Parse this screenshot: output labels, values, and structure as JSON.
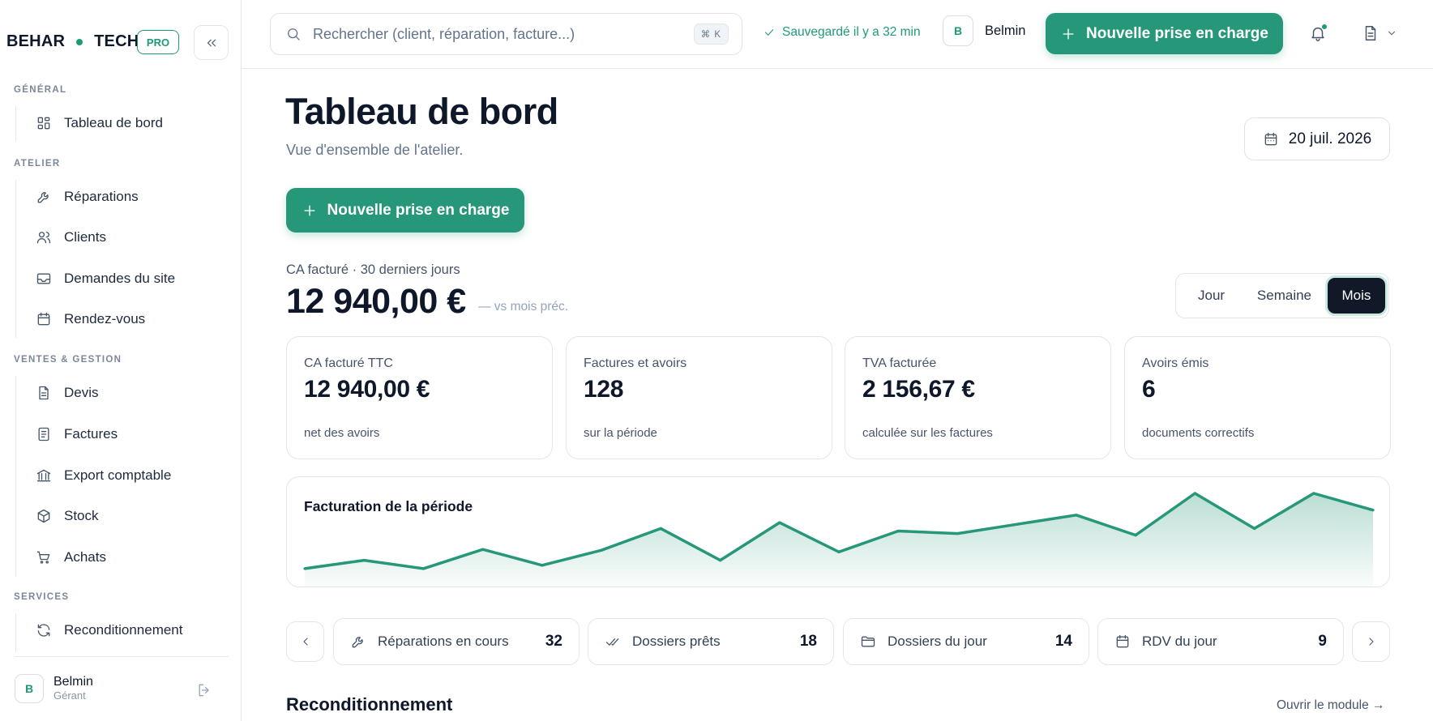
{
  "brand": {
    "left": "BEHAR",
    "right": "TECH",
    "badge": "PRO"
  },
  "sidebar": {
    "sections": [
      "GÉNÉRAL",
      "ATELIER",
      "VENTES & GESTION",
      "SERVICES"
    ],
    "items": [
      {
        "label": "Tableau de bord",
        "icon": "grid-icon"
      },
      {
        "label": "Réparations",
        "icon": "wrench-icon"
      },
      {
        "label": "Clients",
        "icon": "users-icon"
      },
      {
        "label": "Demandes du site",
        "icon": "inbox-icon"
      },
      {
        "label": "Rendez-vous",
        "icon": "calendar-icon"
      },
      {
        "label": "Devis",
        "icon": "document-icon"
      },
      {
        "label": "Factures",
        "icon": "invoice-icon"
      },
      {
        "label": "Export comptable",
        "icon": "bank-icon"
      },
      {
        "label": "Stock",
        "icon": "box-icon"
      },
      {
        "label": "Achats",
        "icon": "cart-icon"
      },
      {
        "label": "Reconditionnement",
        "icon": "refresh-icon"
      }
    ],
    "user": {
      "initial": "B",
      "name": "Belmin",
      "role": "Gérant"
    }
  },
  "topbar": {
    "search_placeholder": "Rechercher (client, réparation, facture...)",
    "shortcut": "⌘ K",
    "saved": "Sauvegardé il y a 32 min",
    "user_initial": "B",
    "user_name": "Belmin",
    "new_button": "Nouvelle prise en charge"
  },
  "main": {
    "title": "Tableau de bord",
    "subtitle": "Vue d'ensemble de l'atelier.",
    "date": "20 juil. 2026",
    "new_button": "Nouvelle prise en charge",
    "ca_label": "CA facturé · 30 derniers jours",
    "ca_value": "12 940,00 €",
    "ca_vs": "— vs mois préc.",
    "periods": [
      "Jour",
      "Semaine",
      "Mois"
    ],
    "active_period": "Mois",
    "cards": [
      {
        "label": "CA facturé TTC",
        "value": "12 940,00 €",
        "sub": "net des avoirs"
      },
      {
        "label": "Factures et avoirs",
        "value": "128",
        "sub": "sur la période"
      },
      {
        "label": "TVA facturée",
        "value": "2 156,67 €",
        "sub": "calculée sur les factures"
      },
      {
        "label": "Avoirs émis",
        "value": "6",
        "sub": "documents correctifs"
      }
    ],
    "stats": [
      {
        "label": "Réparations en cours",
        "value": "32",
        "icon": "wrench-icon"
      },
      {
        "label": "Dossiers prêts",
        "value": "18",
        "icon": "double-check-icon"
      },
      {
        "label": "Dossiers du jour",
        "value": "14",
        "icon": "folder-icon"
      },
      {
        "label": "RDV du jour",
        "value": "9",
        "icon": "calendar-icon"
      }
    ],
    "section_title": "Reconditionnement",
    "section_link": "Ouvrir le module →"
  },
  "colors": {
    "accent": "#27977a",
    "dark": "#111827"
  },
  "chart_data": {
    "type": "area",
    "title": "Facturation de la période",
    "values": [
      2,
      12,
      2,
      25,
      6,
      24,
      50,
      12,
      57,
      22,
      47,
      44,
      55,
      66,
      42,
      92,
      50,
      92,
      72
    ]
  }
}
